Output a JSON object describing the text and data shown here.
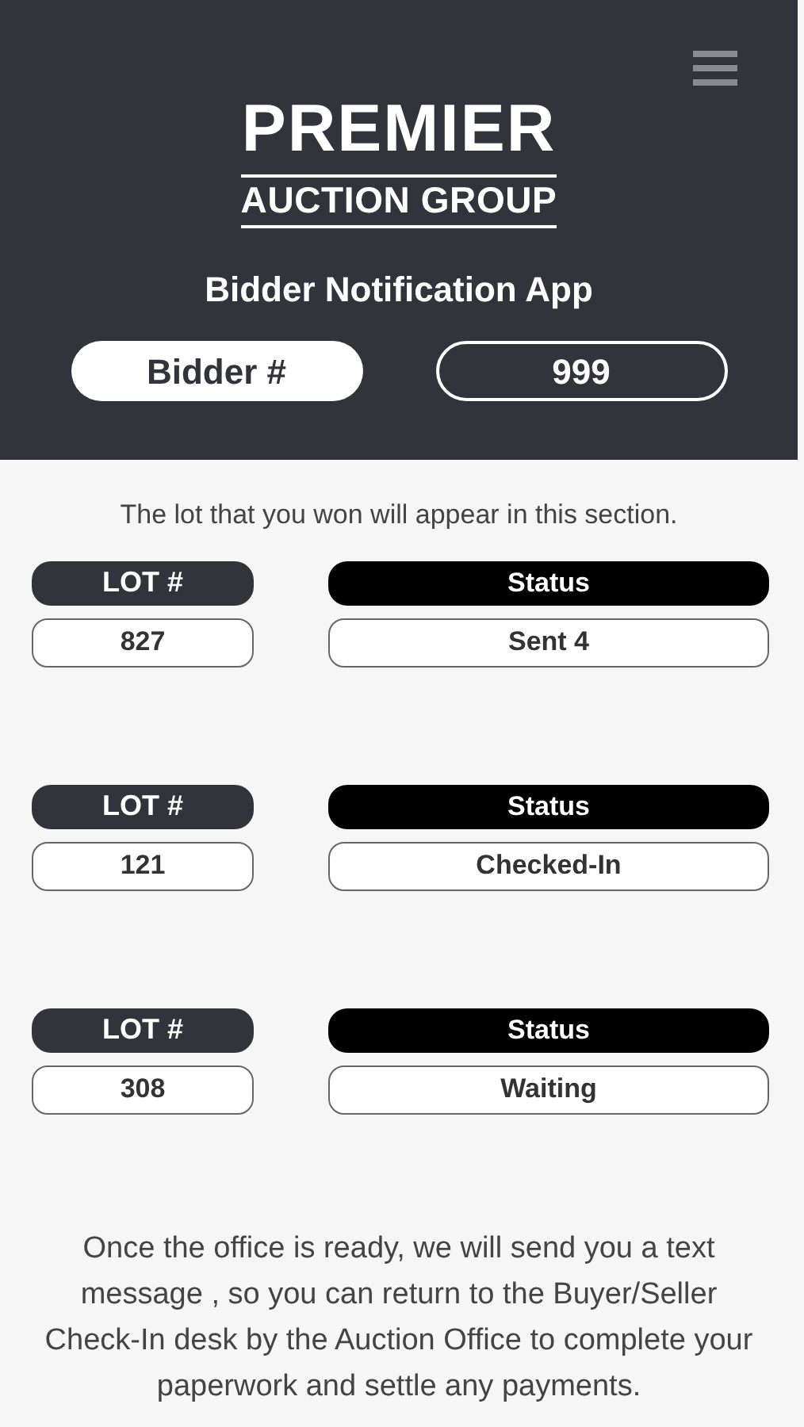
{
  "header": {
    "brand_title": "PREMIER",
    "brand_subtitle": "AUCTION GROUP",
    "app_title": "Bidder Notification App",
    "bidder_label": "Bidder #",
    "bidder_number": "999"
  },
  "intro": "The lot that you won will appear in this section.",
  "lots": [
    {
      "lot_label": "LOT #",
      "lot_number": "827",
      "status_label": "Status",
      "status": "Sent 4"
    },
    {
      "lot_label": "LOT #",
      "lot_number": "121",
      "status_label": "Status",
      "status": "Checked-In"
    },
    {
      "lot_label": "LOT #",
      "lot_number": "308",
      "status_label": "Status",
      "status": "Waiting"
    }
  ],
  "footer_note": "Once the office is ready, we will send you a text message , so you can return to the Buyer/Seller Check-In desk by the Auction Office to complete your paperwork and settle any payments."
}
